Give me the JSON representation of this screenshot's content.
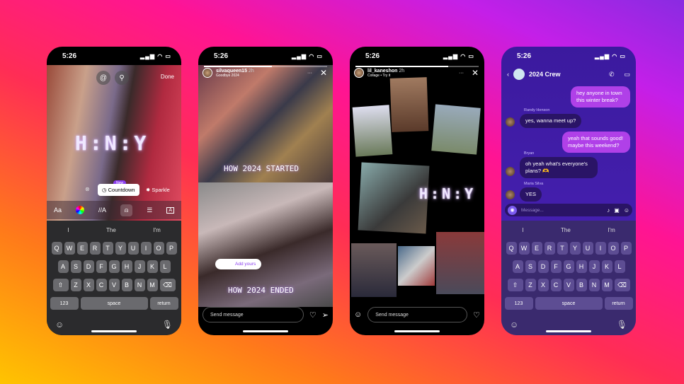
{
  "status_time": "5:26",
  "keyboard": {
    "suggestions": [
      "I",
      "The",
      "I'm"
    ],
    "rows": [
      [
        "Q",
        "W",
        "E",
        "R",
        "T",
        "Y",
        "U",
        "I",
        "O",
        "P"
      ],
      [
        "A",
        "S",
        "D",
        "F",
        "G",
        "H",
        "J",
        "K",
        "L"
      ],
      [
        "Z",
        "X",
        "C",
        "V",
        "B",
        "N",
        "M"
      ]
    ],
    "num_label": "123",
    "space_label": "space",
    "return_label": "return"
  },
  "phone1": {
    "done_label": "Done",
    "sticker_text": "H:N:Y",
    "new_badge": "New",
    "countdown_label": "Countdown",
    "sparkle_label": "Sparkle",
    "tools": [
      "Aa",
      "//A",
      "A"
    ]
  },
  "phone2": {
    "username": "silvaqueen15",
    "time": "2h",
    "subtitle": "Goodbye 2024",
    "text_top": "HOW 2024 STARTED",
    "text_bottom": "HOW 2024 ENDED",
    "add_yours": "Add yours",
    "send_placeholder": "Send message"
  },
  "phone3": {
    "username": "lil_kaneshon",
    "time": "2h",
    "subtitle": "Collage • Try it",
    "sticker_text": "H:N:Y",
    "send_placeholder": "Send message"
  },
  "phone4": {
    "chat_title": "2024 Crew",
    "messages": [
      {
        "from": "me",
        "text": "hey anyone in town this winter break?"
      },
      {
        "from": "Randy Henson",
        "text": "yes, wanna meet up?"
      },
      {
        "from": "me",
        "text": "yeah that sounds good! maybe this weekend?"
      },
      {
        "from": "Bryan",
        "text": "oh yeah what's everyone's plans? 🫶"
      },
      {
        "from": "Maria Silva",
        "text": "YES"
      }
    ],
    "message_placeholder": "Message..."
  },
  "colors": {
    "chat_bg": "#3b1a9e",
    "outgoing_bubble": "#b040e8",
    "incoming_bubble": "#2a1466"
  }
}
